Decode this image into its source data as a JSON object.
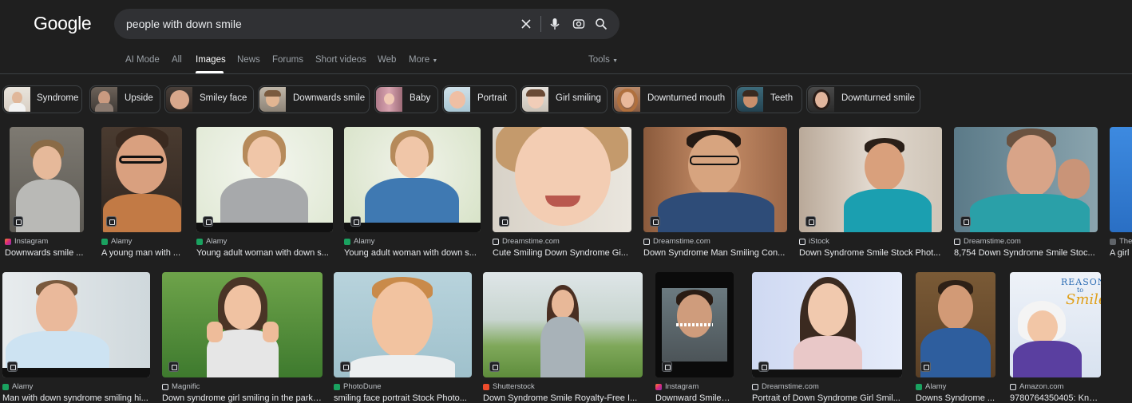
{
  "logo": "Google",
  "search": {
    "query": "people with down smile"
  },
  "tabs": [
    {
      "label": "AI Mode"
    },
    {
      "label": "All"
    },
    {
      "label": "Images"
    },
    {
      "label": "News"
    },
    {
      "label": "Forums"
    },
    {
      "label": "Short videos"
    },
    {
      "label": "Web"
    },
    {
      "label": "More"
    }
  ],
  "tools": "Tools",
  "chips": [
    {
      "label": "Syndrome"
    },
    {
      "label": "Upside"
    },
    {
      "label": "Smiley face"
    },
    {
      "label": "Downwards smile"
    },
    {
      "label": "Baby"
    },
    {
      "label": "Portrait"
    },
    {
      "label": "Girl smiling"
    },
    {
      "label": "Downturned mouth"
    },
    {
      "label": "Teeth"
    },
    {
      "label": "Downturned smile"
    }
  ],
  "row1": [
    {
      "source": "Instagram",
      "title": "Downwards smile ..."
    },
    {
      "source": "Alamy",
      "title": "A young man with ..."
    },
    {
      "source": "Alamy",
      "title": "Young adult woman with down s..."
    },
    {
      "source": "Alamy",
      "title": "Young adult woman with down s..."
    },
    {
      "source": "Dreamstime.com",
      "title": "Cute Smiling Down Syndrome Gi..."
    },
    {
      "source": "Dreamstime.com",
      "title": "Down Syndrome Man Smiling Con..."
    },
    {
      "source": "iStock",
      "title": "Down Syndrome Smile Stock Phot..."
    },
    {
      "source": "Dreamstime.com",
      "title": "8,754 Down Syndrome Smile Stoc..."
    },
    {
      "source": "The",
      "title": "A girl"
    }
  ],
  "row2": [
    {
      "source": "Alamy",
      "title": "Man with down syndrome smiling hi..."
    },
    {
      "source": "Magnific",
      "title": "Down syndrome girl smiling in the park ..."
    },
    {
      "source": "PhotoDune",
      "title": "smiling face portrait Stock Photo..."
    },
    {
      "source": "Shutterstock",
      "title": "Down Syndrome Smile Royalty-Free I..."
    },
    {
      "source": "Instagram",
      "title": "Downward Smile V..."
    },
    {
      "source": "Dreamstime.com",
      "title": "Portrait of Down Syndrome Girl Smil..."
    },
    {
      "source": "Alamy",
      "title": "Downs Syndrome ..."
    },
    {
      "source": "Amazon.com",
      "title": "9780764350405: Knauss..."
    }
  ],
  "book_cover": {
    "title_top": "REASONS",
    "title_mid": "to",
    "title_bot": "Smile"
  },
  "colors": {
    "background": "#1f1f1f",
    "search_bg": "#303134",
    "text": "#e8eaed",
    "muted": "#9aa0a6"
  }
}
